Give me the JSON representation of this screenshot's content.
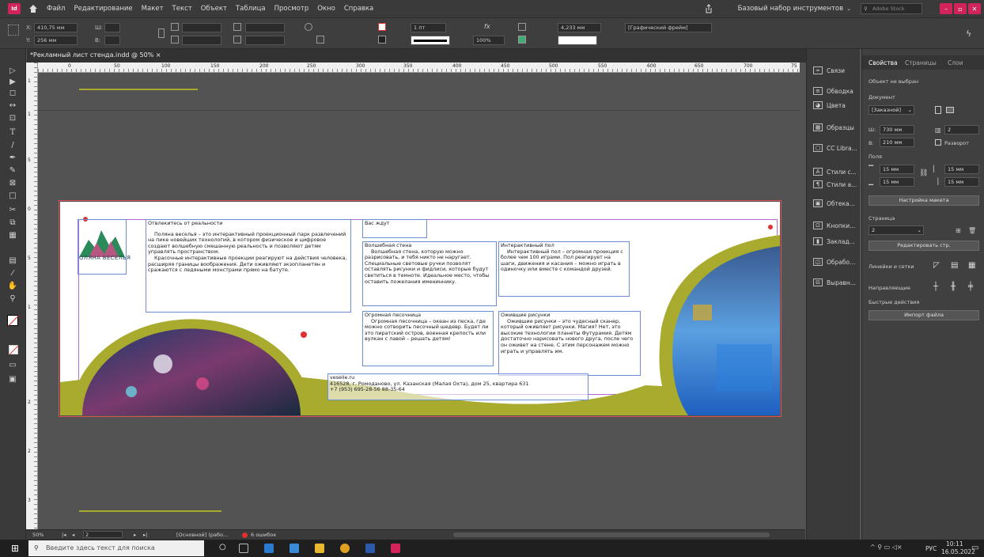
{
  "menu": {
    "items": [
      "Файл",
      "Редактирование",
      "Макет",
      "Текст",
      "Объект",
      "Таблица",
      "Просмотр",
      "Окно",
      "Справка"
    ],
    "workspace": "Базовый набор инструментов",
    "search_placeholder": "Adobe Stock",
    "app_logo": "Id"
  },
  "control": {
    "x_label": "X:",
    "x_value": "410,75 мм",
    "y_label": "Y:",
    "y_value": "256 мм",
    "w_label": "Ш:",
    "h_label": "В:",
    "stroke_weight": "1 пт",
    "opacity": "100%",
    "size_value": "4,233 мм",
    "frame_type": "[Графический фрейм]"
  },
  "document": {
    "tab_title": "*Рекламный лист стенда.indd @ 50%",
    "close_glyph": "×"
  },
  "ruler": {
    "h_ticks": [
      "0",
      "50",
      "100",
      "150",
      "200",
      "250",
      "300",
      "350",
      "400",
      "450",
      "500",
      "550",
      "600",
      "650",
      "700",
      "75"
    ],
    "v_ticks": [
      "1",
      "1",
      "0",
      "5",
      "5",
      "1",
      "2",
      "2",
      "3"
    ]
  },
  "page": {
    "logo_text": "ОЛЯНА ВЕСЕЛЬЯ",
    "intro_heading": "Отвлекитесь от реальности",
    "intro_body_1": "Поляна веселья – это интерактивный проекционный парк развлечений на пике новейших технологий, в котором физическое и цифровое создают волшебную смешанную реальность и позволяют детям управлять пространством.",
    "intro_body_2": "Красочные интерактивные проекции реагируют на действия человека, расширяя границы воображения. Дети оживляют экзопланетян и сражаются с ледяными монстрами прямо на батуте.",
    "waiting": "Вас ждут",
    "wall_title": "Волшебная стена",
    "wall_body": "Волшебная стена, которую можно разрисовать, и тебя никто не наругает. Специальные световые ручки позволят оставлять рисунки и фидлиси, которые будут светиться в темноте. Идеальное место, чтобы оставить пожелания имениннику.",
    "floor_title": "Интерактивный пол",
    "floor_body": "Интерактивный пол – огромная проекция с более чем 100 играми. Пол реагирует на шаги, движения и касания – можно играть в одиночку или вместе с командой друзей.",
    "sand_title": "Огромная песочница",
    "sand_body": "Огромная песочница – океан из песка, где можно сотворить песочный шедевр. Будет ли это пиратский остров, военная крепость или вулкан с лавой – решать детям!",
    "drawings_title": "Ожившие рисунки",
    "drawings_body": "Ожившие рисунки – это чудесный сканер, который оживляет рисунки. Магия? Нет, это высокие технологии планеты Футурамия. Детям достаточно нарисовать нового друга, после чего он оживет на стене. С этим персонажем можно играть и управлять им.",
    "contact_site": "veselie.ru",
    "contact_address": "416528, г. Ромоданово, ул. Казанская (Малая Охта), дом 25, квартира 631",
    "contact_phone": "+7 (953) 695-28-56    88-35-64"
  },
  "panel_strip": [
    "Связи",
    "Обводка",
    "Цвета",
    "Образцы",
    "CC Libra...",
    "Стили с...",
    "Стили а...",
    "Обтека...",
    "Кнопки...",
    "Заклад...",
    "Обрабо...",
    "Выравн..."
  ],
  "props": {
    "tabs": [
      "Свойства",
      "Страницы",
      "Слои"
    ],
    "no_selection": "Объект не выбран",
    "document_label": "Документ",
    "preset": "[Заказной]",
    "width_label": "Ш:",
    "width_value": "730 мм",
    "height_label": "В:",
    "height_value": "210 мм",
    "pages_count": "2",
    "spread_label": "Разворот",
    "margins_label": "Поля",
    "margin_top": "15 мм",
    "margin_bottom": "15 мм",
    "margin_left": "15 мм",
    "margin_right": "15 мм",
    "layout_button": "Настройка макета",
    "page_label": "Страница",
    "page_value": "2",
    "edit_page_button": "Редактировать стр.",
    "rulers_grids": "Линейки и сетки",
    "guides": "Направляющие",
    "quick_actions": "Быстрые действия",
    "import_button": "Импорт файла"
  },
  "status": {
    "zoom": "50%",
    "page": "2",
    "profile": "[Основной] (рабо...",
    "errors": "6 ошибок"
  },
  "taskbar": {
    "search_placeholder": "Введите здесь текст для поиска",
    "lang": "РУС",
    "time": "10:11",
    "date": "16.05.2022"
  },
  "colors": {
    "accent": "#d0245b",
    "olive": "#a8ab2e",
    "frame": "#6b8fd6"
  }
}
